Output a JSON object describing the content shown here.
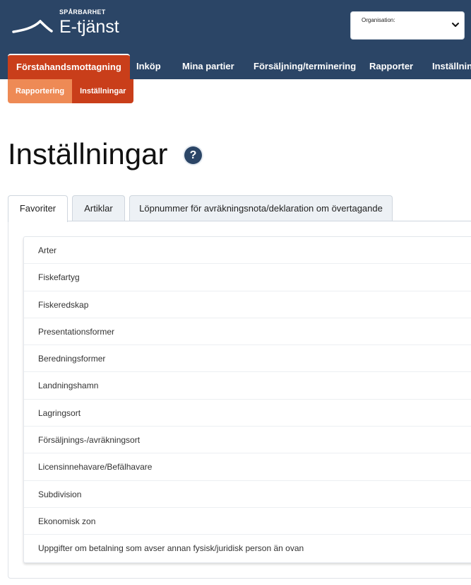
{
  "header": {
    "brand_small": "SPÅRBARHET",
    "brand_big": "E-tjänst",
    "org_label": "Organisation:",
    "org_value": "",
    "colors": {
      "header_bg": "#2b4566",
      "accent": "#c93e1a",
      "accent_light": "#ee8a55"
    }
  },
  "nav": {
    "items": [
      {
        "label": "Förstahandsmottagning",
        "active": true
      },
      {
        "label": "Inköp"
      },
      {
        "label": "Mina partier"
      },
      {
        "label": "Försäljning/terminering"
      },
      {
        "label": "Rapporter"
      },
      {
        "label": "Inställning"
      }
    ]
  },
  "subnav": {
    "items": [
      {
        "label": "Rapportering"
      },
      {
        "label": "Inställningar",
        "active": true
      }
    ]
  },
  "page": {
    "title": "Inställningar",
    "help": "?"
  },
  "tabs": [
    {
      "label": "Favoriter",
      "active": true
    },
    {
      "label": "Artiklar"
    },
    {
      "label": "Löpnummer för avräkningsnota/deklaration om övertagande"
    }
  ],
  "favorites": [
    "Arter",
    "Fiskefartyg",
    "Fiskeredskap",
    "Presentationsformer",
    "Beredningsformer",
    "Landningshamn",
    "Lagringsort",
    "Försäljnings-/avräkningsort",
    "Licensinnehavare/Befälhavare",
    "Subdivision",
    "Ekonomisk zon",
    "Uppgifter om betalning som avser annan fysisk/juridisk person än ovan"
  ]
}
